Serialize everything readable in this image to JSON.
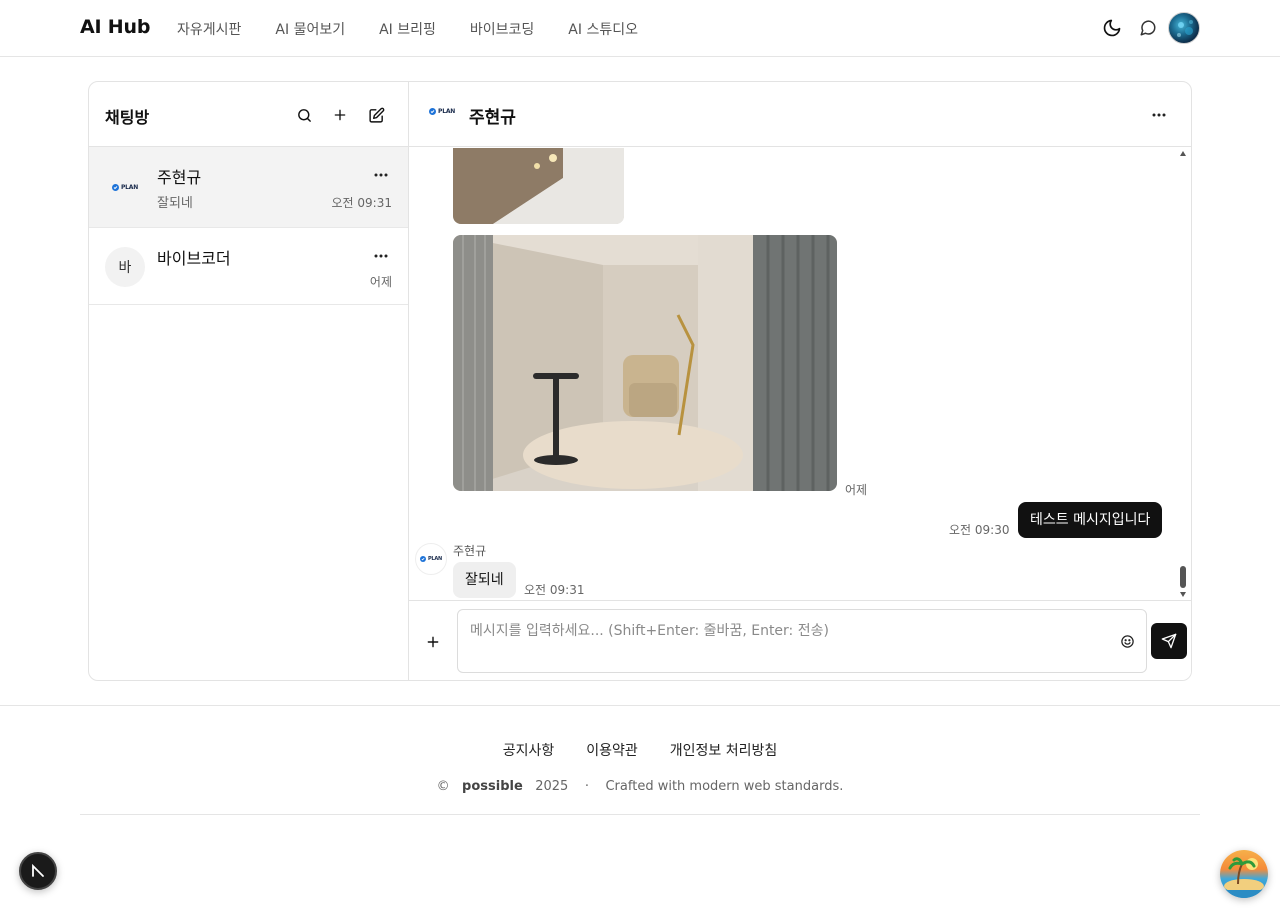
{
  "header": {
    "brand": "AI Hub",
    "nav": [
      "자유게시판",
      "AI 물어보기",
      "AI 브리핑",
      "바이브코딩",
      "AI 스튜디오"
    ]
  },
  "sidebar": {
    "title": "채팅방",
    "rooms": [
      {
        "name": "주현규",
        "last_message": "잘되네",
        "time": "오전 09:31",
        "avatar": "PLAN"
      },
      {
        "name": "바이브코더",
        "last_message": "",
        "time": "어제",
        "avatar": "바"
      }
    ]
  },
  "chat": {
    "title": "주현규",
    "avatar": "PLAN",
    "messages": {
      "image_time": "어제",
      "mine_time": "오전 09:30",
      "mine_text": "테스트 메시지입니다",
      "their_sender": "주현규",
      "their_text": "잘되네",
      "their_time": "오전 09:31"
    },
    "composer": {
      "placeholder": "메시지를 입력하세요... (Shift+Enter: 줄바꿈, Enter: 전송)"
    }
  },
  "footer": {
    "links": [
      "공지사항",
      "이용약관",
      "개인정보 처리방침"
    ],
    "copyright_symbol": "©",
    "owner": "possible",
    "year": "2025",
    "separator": "·",
    "tagline": "Crafted with modern web standards."
  },
  "icons": [
    "moon-icon",
    "chat-bubble-icon",
    "search-icon",
    "plus-icon",
    "edit-icon",
    "more-icon",
    "emoji-icon",
    "send-icon"
  ]
}
